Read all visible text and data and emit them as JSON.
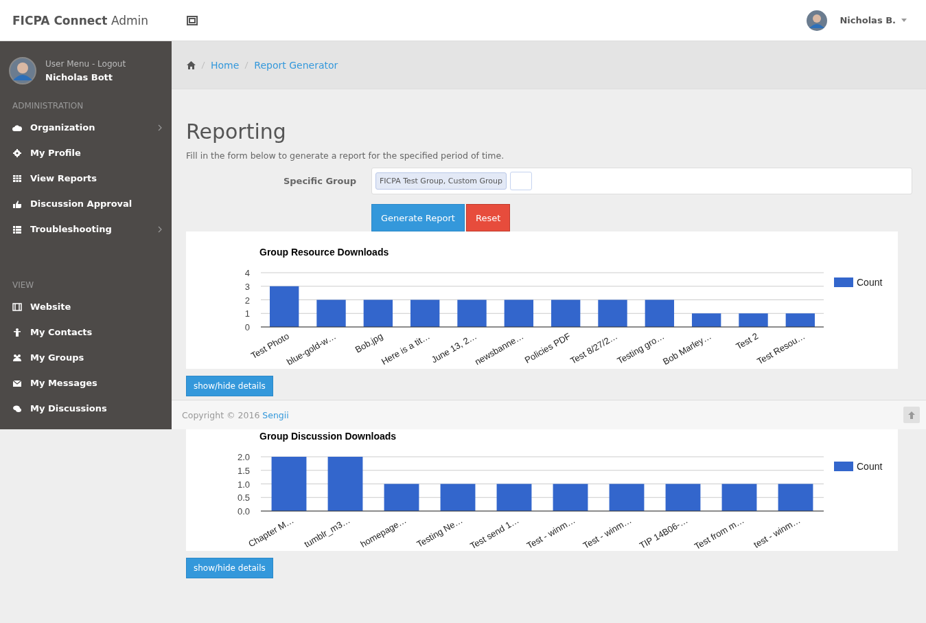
{
  "header": {
    "brand_bold": "FICPA Connect",
    "brand_light": "Admin",
    "user_name": "Nicholas B."
  },
  "sidebar": {
    "user_menu": "User Menu - Logout",
    "user_name": "Nicholas Bott",
    "sections": [
      {
        "title": "ADMINISTRATION",
        "items": [
          {
            "label": "Organization",
            "has_submenu": true
          },
          {
            "label": "My Profile",
            "has_submenu": false
          },
          {
            "label": "View Reports",
            "has_submenu": false
          },
          {
            "label": "Discussion Approval",
            "has_submenu": false
          },
          {
            "label": "Troubleshooting",
            "has_submenu": true
          }
        ]
      },
      {
        "title": "VIEW",
        "items": [
          {
            "label": "Website",
            "has_submenu": false
          },
          {
            "label": "My Contacts",
            "has_submenu": false
          },
          {
            "label": "My Groups",
            "has_submenu": false
          },
          {
            "label": "My Messages",
            "has_submenu": false
          },
          {
            "label": "My Discussions",
            "has_submenu": false
          }
        ]
      }
    ]
  },
  "breadcrumb": [
    "Home",
    "Report Generator"
  ],
  "page": {
    "title": "Reporting",
    "description": "Fill in the form below to generate a report for the specified period of time.",
    "form": {
      "label": "Specific Group",
      "tags": [
        "FICPA Test Group, Custom Group"
      ]
    },
    "buttons": [
      "Generate Report",
      "Reset"
    ]
  },
  "charts": [
    {
      "details_button": "show/hide details",
      "chart_data": {
        "type": "bar",
        "title": "Group Resource Downloads",
        "categories": [
          "Test Photo",
          "blue-gold-w…",
          "Bob.jpg",
          "Here is a tit…",
          "June 13, 2…",
          "newsbanne…",
          "Policies PDF",
          "Test 8/27/2…",
          "Testing gro…",
          "Bob Marley…",
          "Test 2",
          "Test Resou…"
        ],
        "series": [
          {
            "name": "Count",
            "color": "#3366cc",
            "values": [
              3,
              2,
              2,
              2,
              2,
              2,
              2,
              2,
              2,
              1,
              1,
              1
            ]
          }
        ],
        "ylim": [
          0,
          4
        ],
        "yticks": [
          0,
          1,
          2,
          3,
          4
        ],
        "grid": true
      }
    },
    {
      "details_button": "show/hide details",
      "chart_data": {
        "type": "bar",
        "title": "Group Discussion Downloads",
        "categories": [
          "Chapter M…",
          "tumblr_m3…",
          "homepage…",
          "Testing Ne…",
          "Test send 1…",
          "Test - winm…",
          "Test - winm…",
          "TIP 14B06-…",
          "Test from m…",
          "test - winm…"
        ],
        "series": [
          {
            "name": "Count",
            "color": "#3366cc",
            "values": [
              2,
              2,
              1,
              1,
              1,
              1,
              1,
              1,
              1,
              1
            ]
          }
        ],
        "ylim": [
          0,
          2
        ],
        "yticks": [
          {
            "value": 0,
            "label": "0.0"
          },
          {
            "value": 0.5,
            "label": "0.5"
          },
          {
            "value": 1,
            "label": "1.0"
          },
          {
            "value": 1.5,
            "label": "1.5"
          },
          {
            "value": 2,
            "label": "2.0"
          }
        ],
        "grid": true
      }
    }
  ],
  "footer": {
    "text": "Copyright © 2016",
    "link": "Sengii"
  }
}
